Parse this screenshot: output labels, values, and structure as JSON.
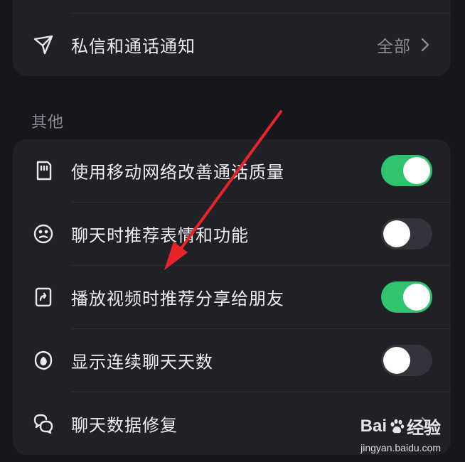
{
  "notification_card": {
    "row": {
      "icon": "paper-plane-icon",
      "label": "私信和通话通知",
      "value": "全部"
    }
  },
  "section": {
    "title": "其他"
  },
  "settings": [
    {
      "icon": "sim-card-icon",
      "label": "使用移动网络改善通话质量",
      "control": "toggle",
      "on": true
    },
    {
      "icon": "emoji-face-icon",
      "label": "聊天时推荐表情和功能",
      "control": "toggle",
      "on": false
    },
    {
      "icon": "share-video-icon",
      "label": "播放视频时推荐分享给朋友",
      "control": "toggle",
      "on": true
    },
    {
      "icon": "flame-icon",
      "label": "显示连续聊天天数",
      "control": "toggle",
      "on": false
    },
    {
      "icon": "chat-repair-icon",
      "label": "聊天数据修复",
      "control": "chevron"
    }
  ],
  "watermark": {
    "logo_text": "Bai",
    "logo_text2": "经验",
    "url": "jingyan.baidu.com"
  },
  "colors": {
    "background": "#16171c",
    "card": "#202127",
    "toggle_on": "#2fc46e",
    "toggle_off": "#33343b",
    "annotation_arrow": "#e8242a"
  }
}
